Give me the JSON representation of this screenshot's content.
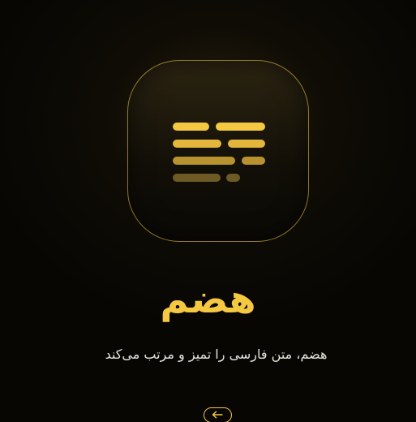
{
  "app": {
    "title": "هضم",
    "tagline": "هضم، متن فارسی را تمیز و مرتب می‌کند",
    "icon": "text-lines-icon",
    "next_icon": "arrow-left-icon"
  },
  "colors": {
    "accent": "#f5c842",
    "background": "#070603",
    "text": "#e8e4da"
  }
}
